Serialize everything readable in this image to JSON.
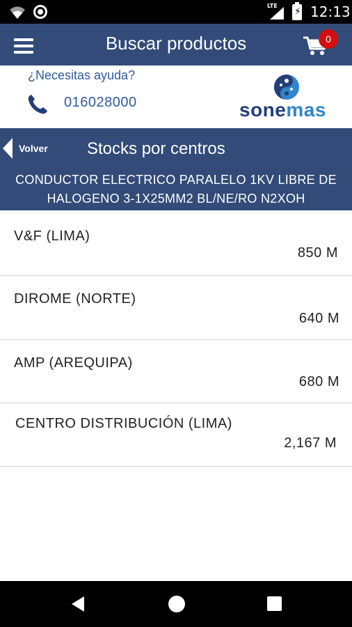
{
  "status_bar": {
    "time": "12:13",
    "network_label": "LTE",
    "icons": [
      "wifi-icon",
      "circle-notification-icon",
      "signal-icon",
      "battery-charging-icon"
    ]
  },
  "app_bar": {
    "title": "Buscar productos",
    "menu_icon": "hamburger-menu-icon",
    "cart_icon": "cart-icon",
    "cart_count": "0",
    "background_color": "#324b78",
    "badge_color": "#d10f0f"
  },
  "help": {
    "question": "¿Necesitas ayuda?",
    "phone_icon": "phone-icon",
    "phone_number": "016028000",
    "logo_text_part1": "sone",
    "logo_text_part2": "mas"
  },
  "section": {
    "back_label": "Volver",
    "title": "Stocks por centros",
    "product_name": "CONDUCTOR ELECTRICO PARALELO 1KV LIBRE DE HALOGENO 3-1X25MM2 BL/NE/RO N2XOH"
  },
  "stocks": [
    {
      "center": "V&F (LIMA)",
      "quantity": "850 M"
    },
    {
      "center": "DIROME (NORTE)",
      "quantity": "640 M"
    },
    {
      "center": "AMP (AREQUIPA)",
      "quantity": "680 M"
    },
    {
      "center": "CENTRO DISTRIBUCIÓN (LIMA)",
      "quantity": "2,167 M"
    }
  ],
  "nav_bar": {
    "icons": [
      "back-triangle-icon",
      "home-circle-icon",
      "recents-square-icon"
    ]
  }
}
